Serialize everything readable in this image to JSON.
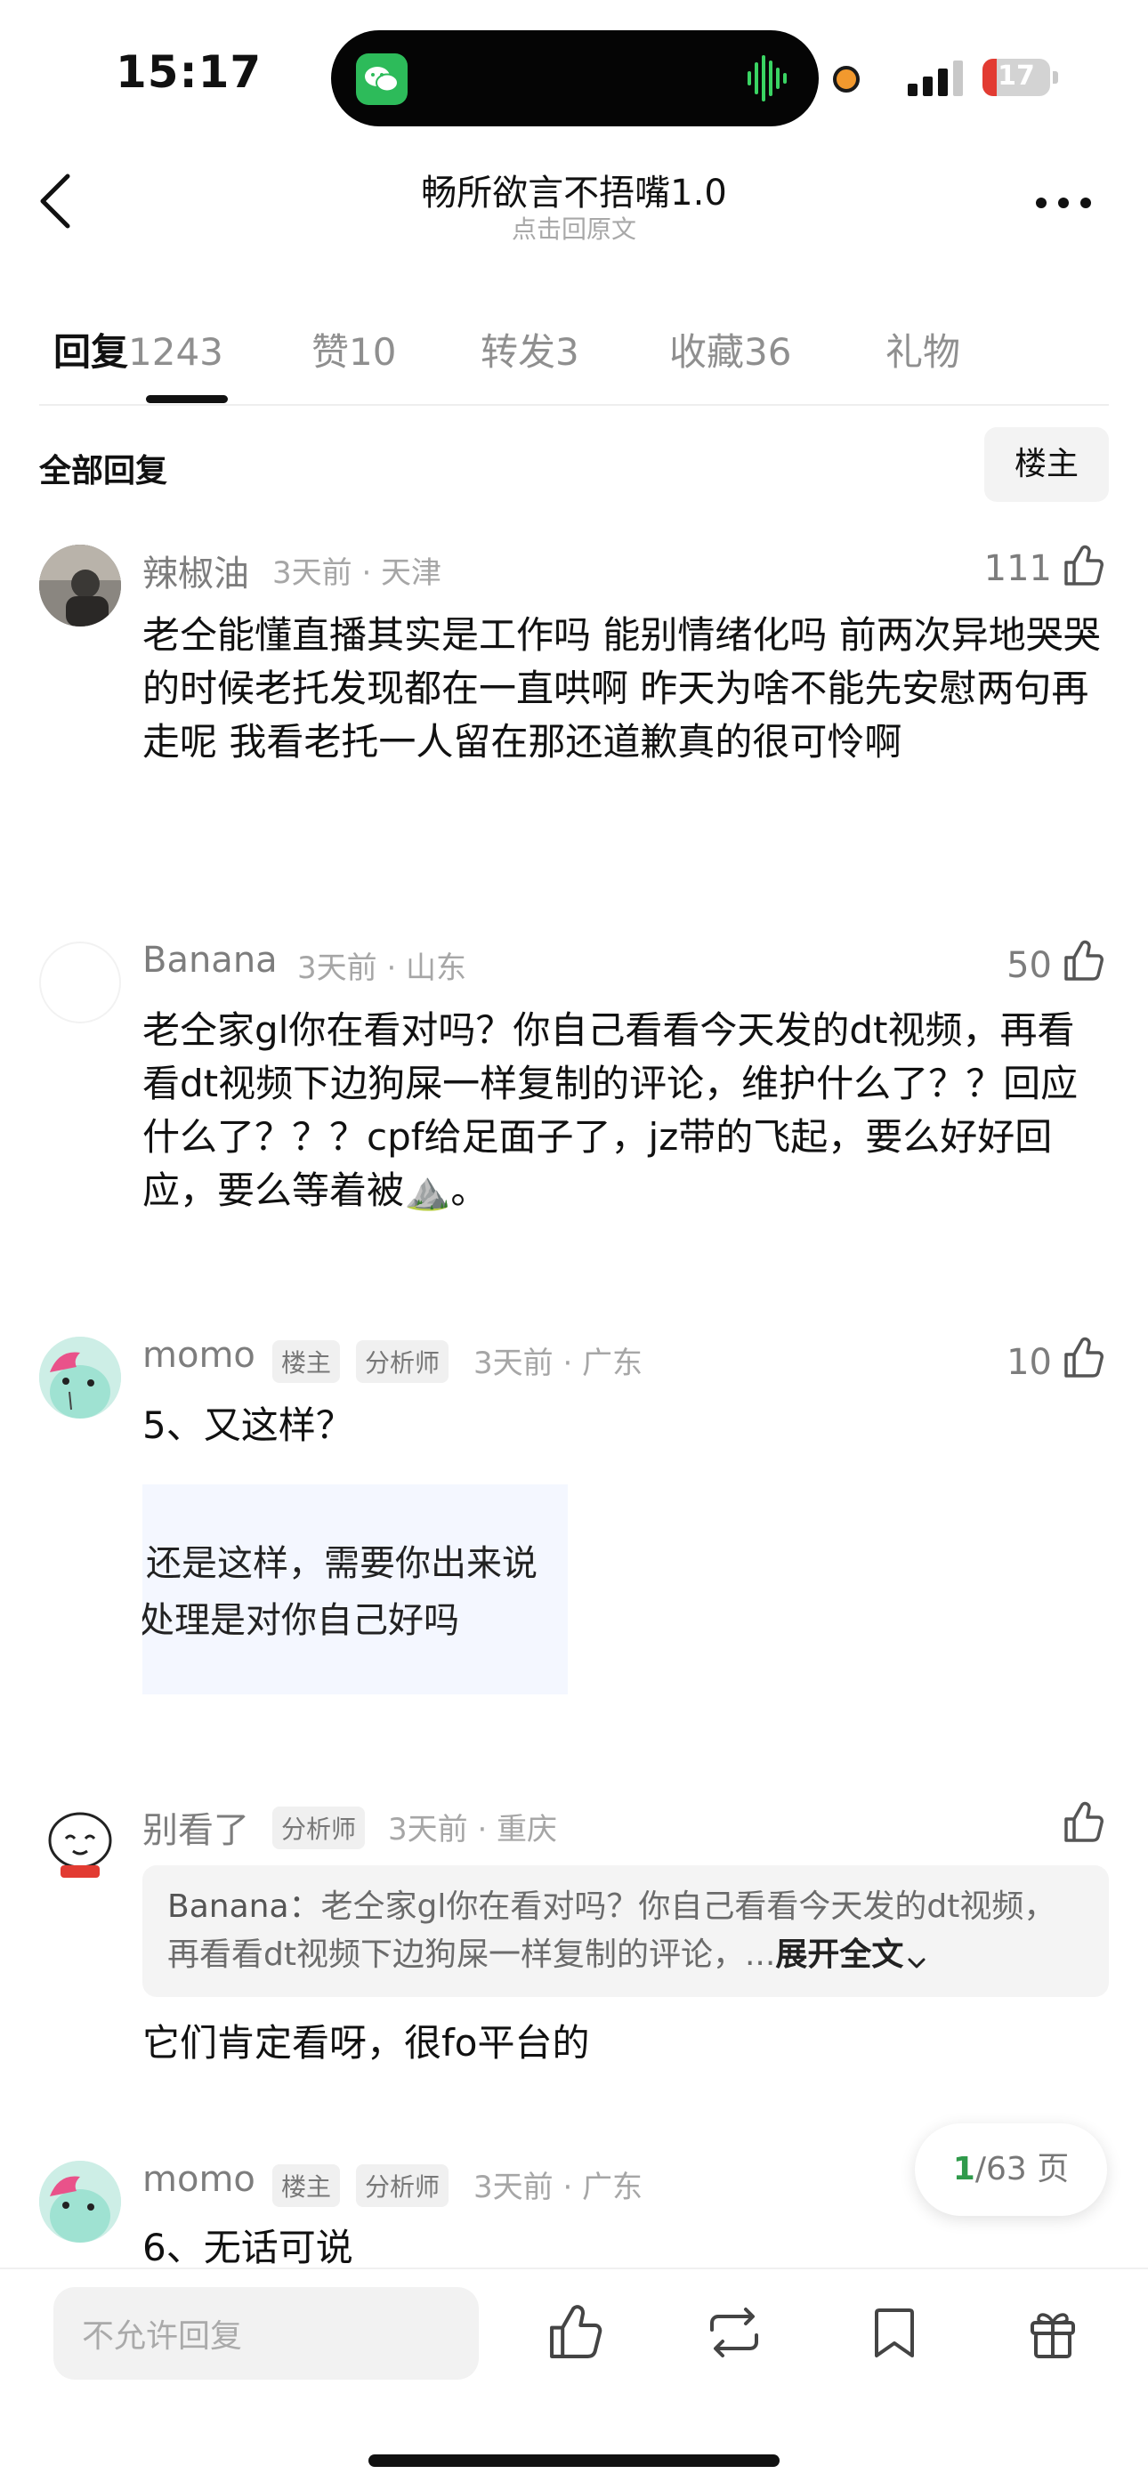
{
  "status_bar": {
    "time": "15:17",
    "battery": "17"
  },
  "nav": {
    "title": "畅所欲言不捂嘴1.0",
    "subtitle": "点击回原文"
  },
  "tabs": [
    {
      "label": "回复",
      "count": "1243"
    },
    {
      "label": "赞",
      "count": "10"
    },
    {
      "label": "转发",
      "count": "3"
    },
    {
      "label": "收藏",
      "count": "36"
    },
    {
      "label": "礼物",
      "count": ""
    }
  ],
  "list_header": {
    "title": "全部回复",
    "filter_button": "楼主"
  },
  "comments": [
    {
      "user": "辣椒油",
      "meta": "3天前 · 天津",
      "likes": "111",
      "text": "老仝能懂直播其实是工作吗 能别情绪化吗 前两次异地哭哭的时候老托发现都在一直哄啊 昨天为啥不能先安慰两句再走呢 我看老托一人留在那还道歉真的很可怜啊"
    },
    {
      "user": "Banana",
      "meta": "3天前 · 山东",
      "likes": "50",
      "text": "老仝家gl你在看对吗？你自己看看今天发的dt视频，再看看dt视频下边狗屎一样复制的评论，维护什么了？？回应什么了？？？cpf给足面子了，jz带的飞起，要么好好回应，要么等着被",
      "emoji": "⛰️",
      "text_end": "。"
    },
    {
      "user": "momo",
      "badges": [
        "楼主",
        "分析师"
      ],
      "meta": "3天前 · 广东",
      "likes": "10",
      "text": "5、又这样？",
      "image_lines": [
        "还是这样，需要你出来说",
        "处理是对你自己好吗"
      ]
    },
    {
      "user": "别看了",
      "badges": [
        "分析师"
      ],
      "meta": "3天前 · 重庆",
      "likes": "",
      "quote": {
        "user": "Banana：",
        "text": "老仝家gl你在看对吗？你自己看看今天发的dt视频，再看看dt视频下边狗屎一样复制的评论，...",
        "expand": "展开全文"
      },
      "text": "它们肯定看呀，很fo平台的"
    },
    {
      "user": "momo",
      "badges": [
        "楼主",
        "分析师"
      ],
      "meta": "3天前 · 广东",
      "text": "6、无话可说"
    }
  ],
  "pager": {
    "current": "1",
    "total": "/63",
    "unit": "页"
  },
  "bottom": {
    "input_placeholder": "不允许回复"
  },
  "colors": {
    "accent_green": "#2f9a4b",
    "wechat_green": "#2dbb5a",
    "battery_red": "#e23b32"
  }
}
